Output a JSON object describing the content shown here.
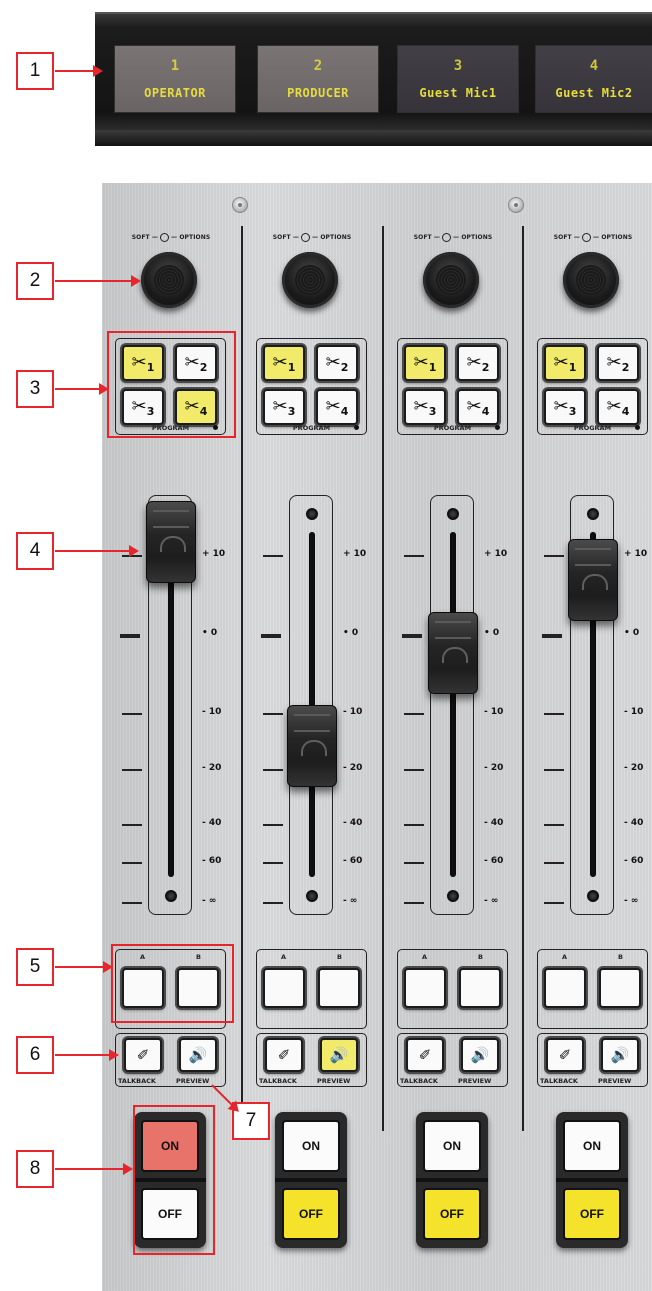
{
  "displays": [
    {
      "num": "1",
      "name": "OPERATOR",
      "lit": true
    },
    {
      "num": "2",
      "name": "PRODUCER",
      "lit": true
    },
    {
      "num": "3",
      "name": "Guest Mic1",
      "lit": false
    },
    {
      "num": "4",
      "name": "Guest Mic2",
      "lit": false
    }
  ],
  "soft_options": {
    "left": "SOFT",
    "right": "OPTIONS"
  },
  "program": {
    "label": "PROGRAM",
    "button_glyph": "✂",
    "buttons": [
      "1",
      "2",
      "3",
      "4"
    ]
  },
  "scale": [
    "+ 10",
    "• 0",
    "- 10",
    "- 20",
    "- 40",
    "- 60",
    "- ∞"
  ],
  "ab": {
    "a": "A",
    "b": "B"
  },
  "talkback_label": "TALKBACK",
  "preview_label": "PREVIEW",
  "talkback_icon": "✐",
  "preview_icon": "🔊",
  "on_label": "ON",
  "off_label": "OFF",
  "strips": [
    {
      "fader_level": 0.97,
      "program_lit": [
        true,
        false,
        false,
        true
      ],
      "preview_on": false,
      "on_active": true,
      "off_lit": false
    },
    {
      "fader_level": 0.38,
      "program_lit": [
        true,
        false,
        false,
        false
      ],
      "preview_on": true,
      "on_active": false,
      "off_lit": true
    },
    {
      "fader_level": 0.65,
      "program_lit": [
        true,
        false,
        false,
        false
      ],
      "preview_on": false,
      "on_active": false,
      "off_lit": true
    },
    {
      "fader_level": 0.86,
      "program_lit": [
        true,
        false,
        false,
        false
      ],
      "preview_on": false,
      "on_active": false,
      "off_lit": true
    }
  ],
  "callouts": [
    "1",
    "2",
    "3",
    "4",
    "5",
    "6",
    "7",
    "8"
  ],
  "colors": {
    "accent_yellow": "#f2ea6a",
    "on_red": "#e8736b",
    "callout_red": "#e6262c",
    "lcd_text": "#e7dc3c"
  }
}
